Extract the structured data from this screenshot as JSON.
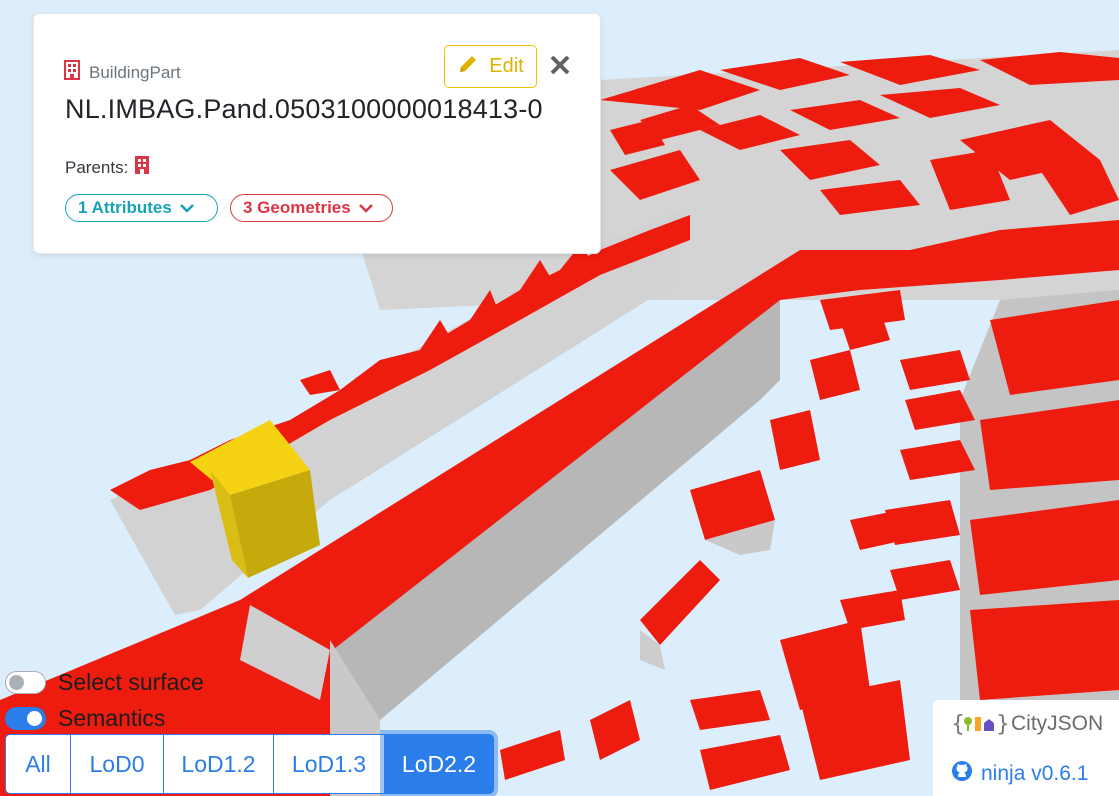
{
  "object_card": {
    "type_label": "BuildingPart",
    "object_id": "NL.IMBAG.Pand.0503100000018413-0",
    "parents_label": "Parents:",
    "edit_label": "Edit",
    "attributes_label": "1 Attributes",
    "geometries_label": "3 Geometries",
    "icons": [
      "building-icon",
      "pencil-icon",
      "close-icon",
      "chevron-down-icon"
    ]
  },
  "toggles": [
    {
      "label": "Select surface",
      "on": false
    },
    {
      "label": "Semantics",
      "on": true
    }
  ],
  "lod_buttons": [
    {
      "label": "All",
      "active": false
    },
    {
      "label": "LoD0",
      "active": false
    },
    {
      "label": "LoD1.2",
      "active": false
    },
    {
      "label": "LoD1.3",
      "active": false
    },
    {
      "label": "LoD2.2",
      "active": true
    }
  ],
  "branding": {
    "logo_text": "CityJSON",
    "app_label": "ninja v0.6.1"
  },
  "colors": {
    "background": "#dceefb",
    "roof": "#ee1c0e",
    "wall": "#d3d3d3",
    "selected": "#f5d313",
    "primary": "#2b7de9",
    "info": "#17a2b8",
    "danger": "#dc3545",
    "warning": "#f2c200"
  }
}
